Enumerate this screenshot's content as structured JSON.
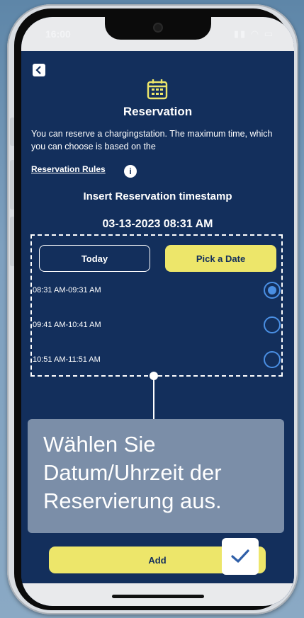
{
  "status": {
    "time": "16:00",
    "icons": "signal wifi battery"
  },
  "header": {
    "title": "Reservation"
  },
  "intro_text": "You can reserve a chargingstation. The maximum time, which you can choose is based on the",
  "rules_link": "Reservation Rules",
  "info_glyph": "i",
  "insert_label": "Insert Reservation timestamp",
  "timestamp": "03-13-2023 08:31 AM",
  "buttons": {
    "today": "Today",
    "pick_date": "Pick a Date",
    "add": "Add"
  },
  "slots": [
    {
      "label": "08:31 AM-09:31 AM",
      "selected": true
    },
    {
      "label": "09:41 AM-10:41 AM",
      "selected": false
    },
    {
      "label": "10:51 AM-11:51 AM",
      "selected": false
    }
  ],
  "tooltip": "Wählen Sie Datum/Uhrzeit der Reservierung aus.",
  "colors": {
    "background": "#132f5c",
    "accent": "#ede66a",
    "radio": "#4a8fe3",
    "tooltip": "#7b8ea8"
  },
  "icons": [
    "back-arrow-icon",
    "calendar-icon",
    "info-icon",
    "check-icon"
  ]
}
